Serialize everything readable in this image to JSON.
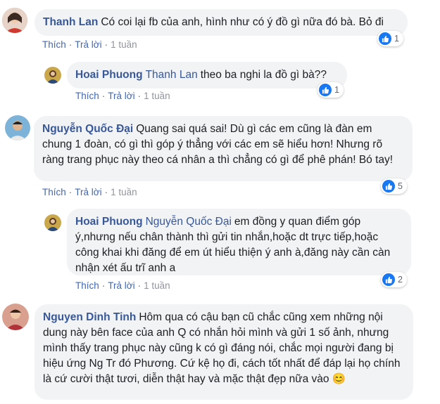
{
  "comments": [
    {
      "author": "Thanh Lan",
      "mention": "",
      "text": "Có coi lại fb của anh, hình như có ý đồ gì nữa đó bà. Bỏ đi",
      "like": "Thích",
      "reply": "Trả lời",
      "time": "1 tuần",
      "reactions": "1"
    },
    {
      "author": "Hoai Phuong",
      "mention": "Thanh Lan",
      "text": "theo ba nghi la đồ gì bà??",
      "like": "Thích",
      "reply": "Trả lời",
      "time": "1 tuần",
      "reactions": "1"
    },
    {
      "author": "Nguyễn Quốc Đại",
      "mention": "",
      "text": "Quang sai quá sai! Dù gì các em cũng là đàn em chung 1 đoàn, có gì thì góp ý thẳng với các em sẽ hiểu hơn! Nhưng rõ ràng trang phục này theo cá nhân a thì chẳng có gì để phê phán! Bó tay!",
      "like": "Thích",
      "reply": "Trả lời",
      "time": "1 tuần",
      "reactions": "5"
    },
    {
      "author": "Hoai Phuong",
      "mention": "Nguyễn Quốc Đại",
      "text": "em đồng y quan điểm góp ý,nhưng nếu chân thành thì gửi tin nhắn,hoặc dt trực tiếp,hoặc công khai khi đăng để em út hiểu thiện ý anh à,đăng này cần càn nhận xét ấu trĩ anh a",
      "like": "Thích",
      "reply": "Trả lời",
      "time": "1 tuần",
      "reactions": "2"
    },
    {
      "author": "Nguyen Dinh Tinh",
      "mention": "",
      "text": "Hôm qua có cậu bạn cũ chắc cũng xem những nội dung này bên face của anh Q có nhắn hỏi mình và gửi 1 số ảnh, nhưng mình thấy trang phục này cũng k có gì đáng nói, chắc mọi người đang bị hiệu ứng Ng Tr đó Phương. Cứ kệ họ đi, cách tốt nhất để đáp lại họ chính là cứ cười thật tươi, diễn thật hay và mặc thật đẹp nữa vào",
      "emoji": "😊"
    }
  ],
  "colors": {
    "link": "#385898",
    "bubble": "#f2f3f5",
    "like_blue": "#1877f2"
  },
  "icons": {
    "like": "thumbs-up-icon"
  }
}
